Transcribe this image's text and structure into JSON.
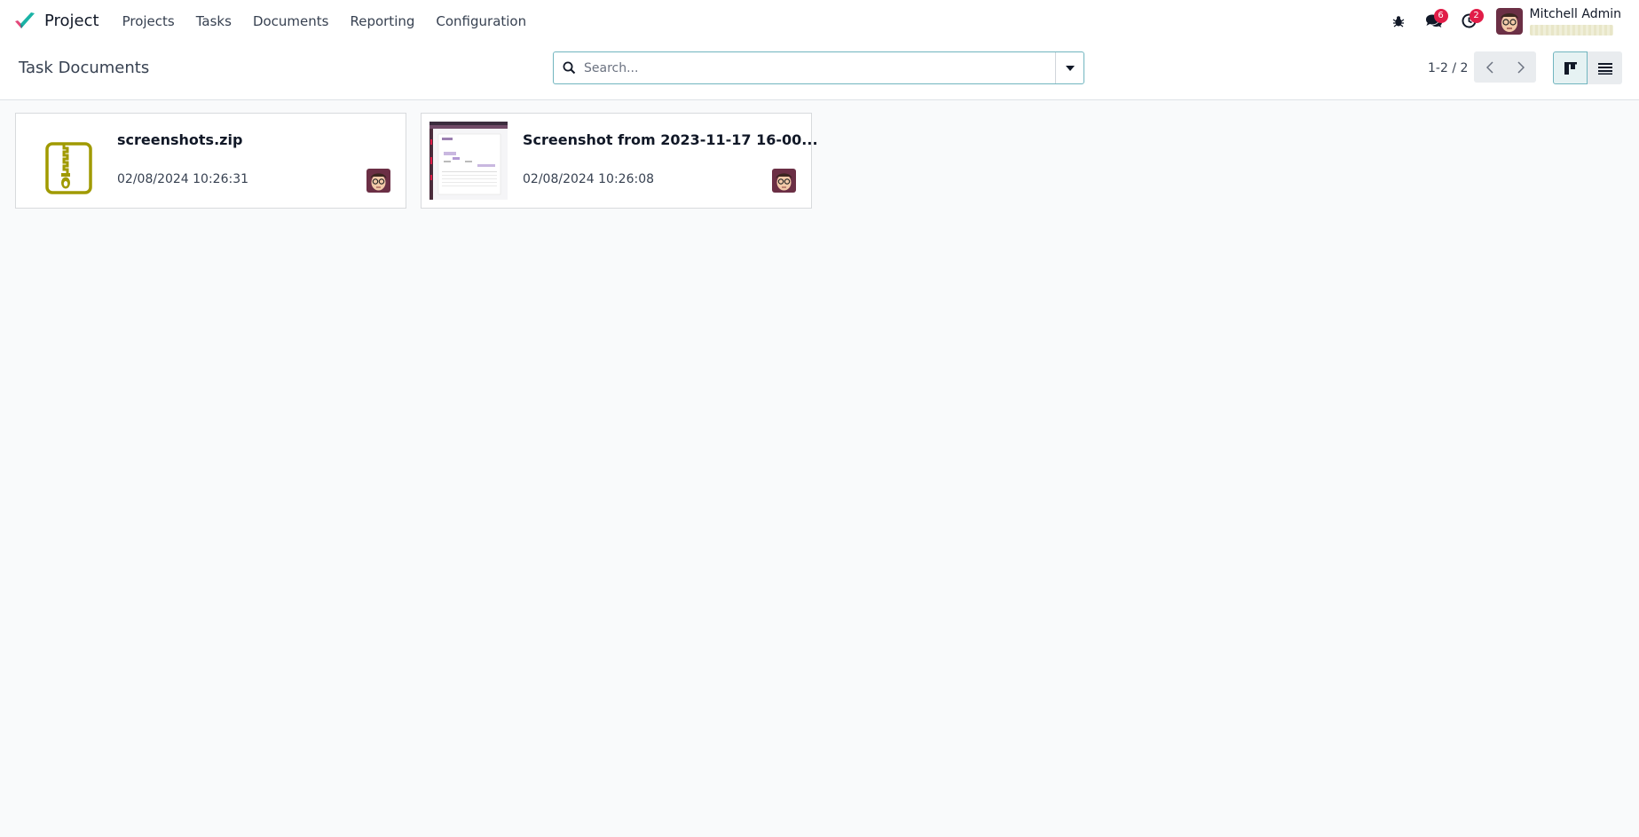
{
  "navbar": {
    "app_name": "Project",
    "menu": [
      "Projects",
      "Tasks",
      "Documents",
      "Reporting",
      "Configuration"
    ],
    "messages_count": "6",
    "activities_count": "2",
    "user_name": "Mitchell Admin",
    "brand_colors": {
      "teal": "#1ab3a6",
      "pink": "#e2487a",
      "dark": "#714b67"
    }
  },
  "control_panel": {
    "breadcrumb": "Task Documents",
    "search_placeholder": "Search...",
    "pager": "1-2 / 2"
  },
  "cards": [
    {
      "title": "screenshots.zip",
      "date": "02/08/2024 10:26:31",
      "thumb": "zip-file-icon"
    },
    {
      "title": "Screenshot from 2023-11-17 16-00...",
      "date": "02/08/2024 10:26:08",
      "thumb": "screenshot-thumbnail"
    }
  ],
  "colors": {
    "accent": "#71b5bf",
    "zip_icon": "#a09a00",
    "badge": "#e11d48",
    "background": "#f9fafb"
  }
}
